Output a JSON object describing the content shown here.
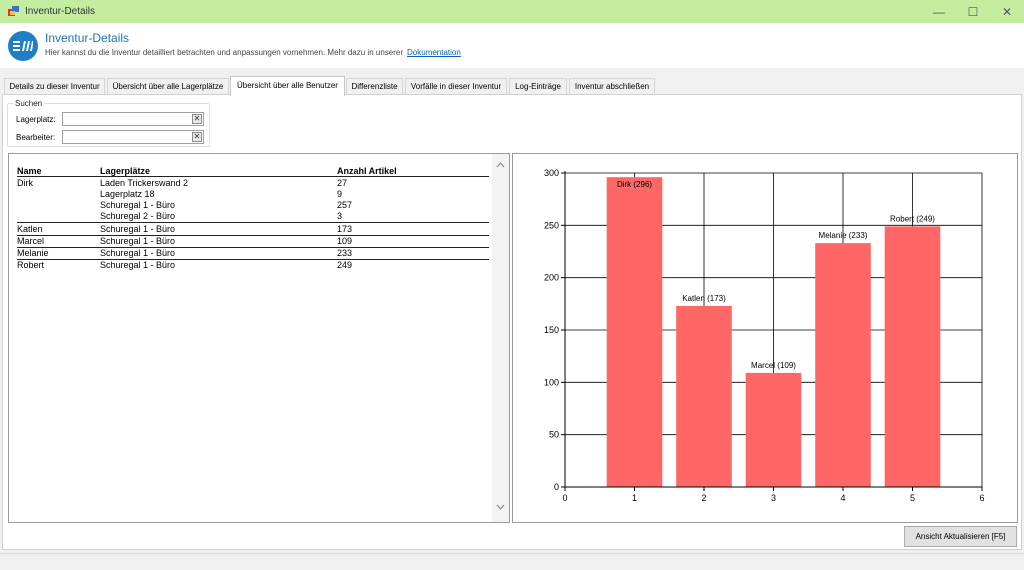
{
  "window": {
    "title": "Inventur-Details",
    "minimize": "—",
    "maximize": "☐",
    "close": "✕"
  },
  "header": {
    "title": "Inventur-Details",
    "subtitle": "Hier kannst du die Inventur detailliert betrachten und anpassungen vornehmen. Mehr dazu in unserer",
    "link": "Dokumentation"
  },
  "tabs": [
    {
      "label": "Details zu dieser Inventur"
    },
    {
      "label": "Übersicht über alle Lagerplätze"
    },
    {
      "label": "Übersicht über alle Benutzer"
    },
    {
      "label": "Differenzliste"
    },
    {
      "label": "Vorfälle in dieser Inventur"
    },
    {
      "label": "Log-Einträge"
    },
    {
      "label": "Inventur abschließen"
    }
  ],
  "active_tab": 2,
  "search": {
    "legend": "Suchen",
    "lagerplatz_label": "Lagerplatz:",
    "lagerplatz_value": "",
    "bearbeiter_label": "Bearbeiter:",
    "bearbeiter_value": "",
    "clear_symbol": "✕"
  },
  "table": {
    "columns": [
      "Name",
      "Lagerplätze",
      "Anzahl Artikel"
    ],
    "rows": [
      {
        "name": "Dirk",
        "lagerplatz": "Laden Trickerswand 2",
        "anzahl": "27"
      },
      {
        "name": "",
        "lagerplatz": "Lagerplatz 18",
        "anzahl": "9"
      },
      {
        "name": "",
        "lagerplatz": "Schuregal 1 - Büro",
        "anzahl": "257"
      },
      {
        "name": "",
        "lagerplatz": "Schuregal 2 - Büro",
        "anzahl": "3"
      },
      {
        "name": "Katlen",
        "lagerplatz": "Schuregal 1 - Büro",
        "anzahl": "173"
      },
      {
        "name": "Marcel",
        "lagerplatz": "Schuregal 1 - Büro",
        "anzahl": "109"
      },
      {
        "name": "Melanie",
        "lagerplatz": "Schuregal 1 - Büro",
        "anzahl": "233"
      },
      {
        "name": "Robert",
        "lagerplatz": "Schuregal 1 - Büro",
        "anzahl": "249"
      }
    ]
  },
  "chart_data": {
    "type": "bar",
    "x": [
      1,
      2,
      3,
      4,
      5
    ],
    "values": [
      296,
      173,
      109,
      233,
      249
    ],
    "labels": [
      "Dirk (296)",
      "Katlen (173)",
      "Marcel (109)",
      "Melanie (233)",
      "Robert (249)"
    ],
    "xlim": [
      0,
      6
    ],
    "ylim": [
      0,
      300
    ],
    "xticks": [
      0,
      1,
      2,
      3,
      4,
      5,
      6
    ],
    "yticks": [
      0,
      50,
      100,
      150,
      200,
      250,
      300
    ],
    "grid": true,
    "bar_color": "#ff6666",
    "title": "",
    "xlabel": "",
    "ylabel": ""
  },
  "footer": {
    "refresh_label": "Ansicht Aktualisieren [F5]"
  }
}
